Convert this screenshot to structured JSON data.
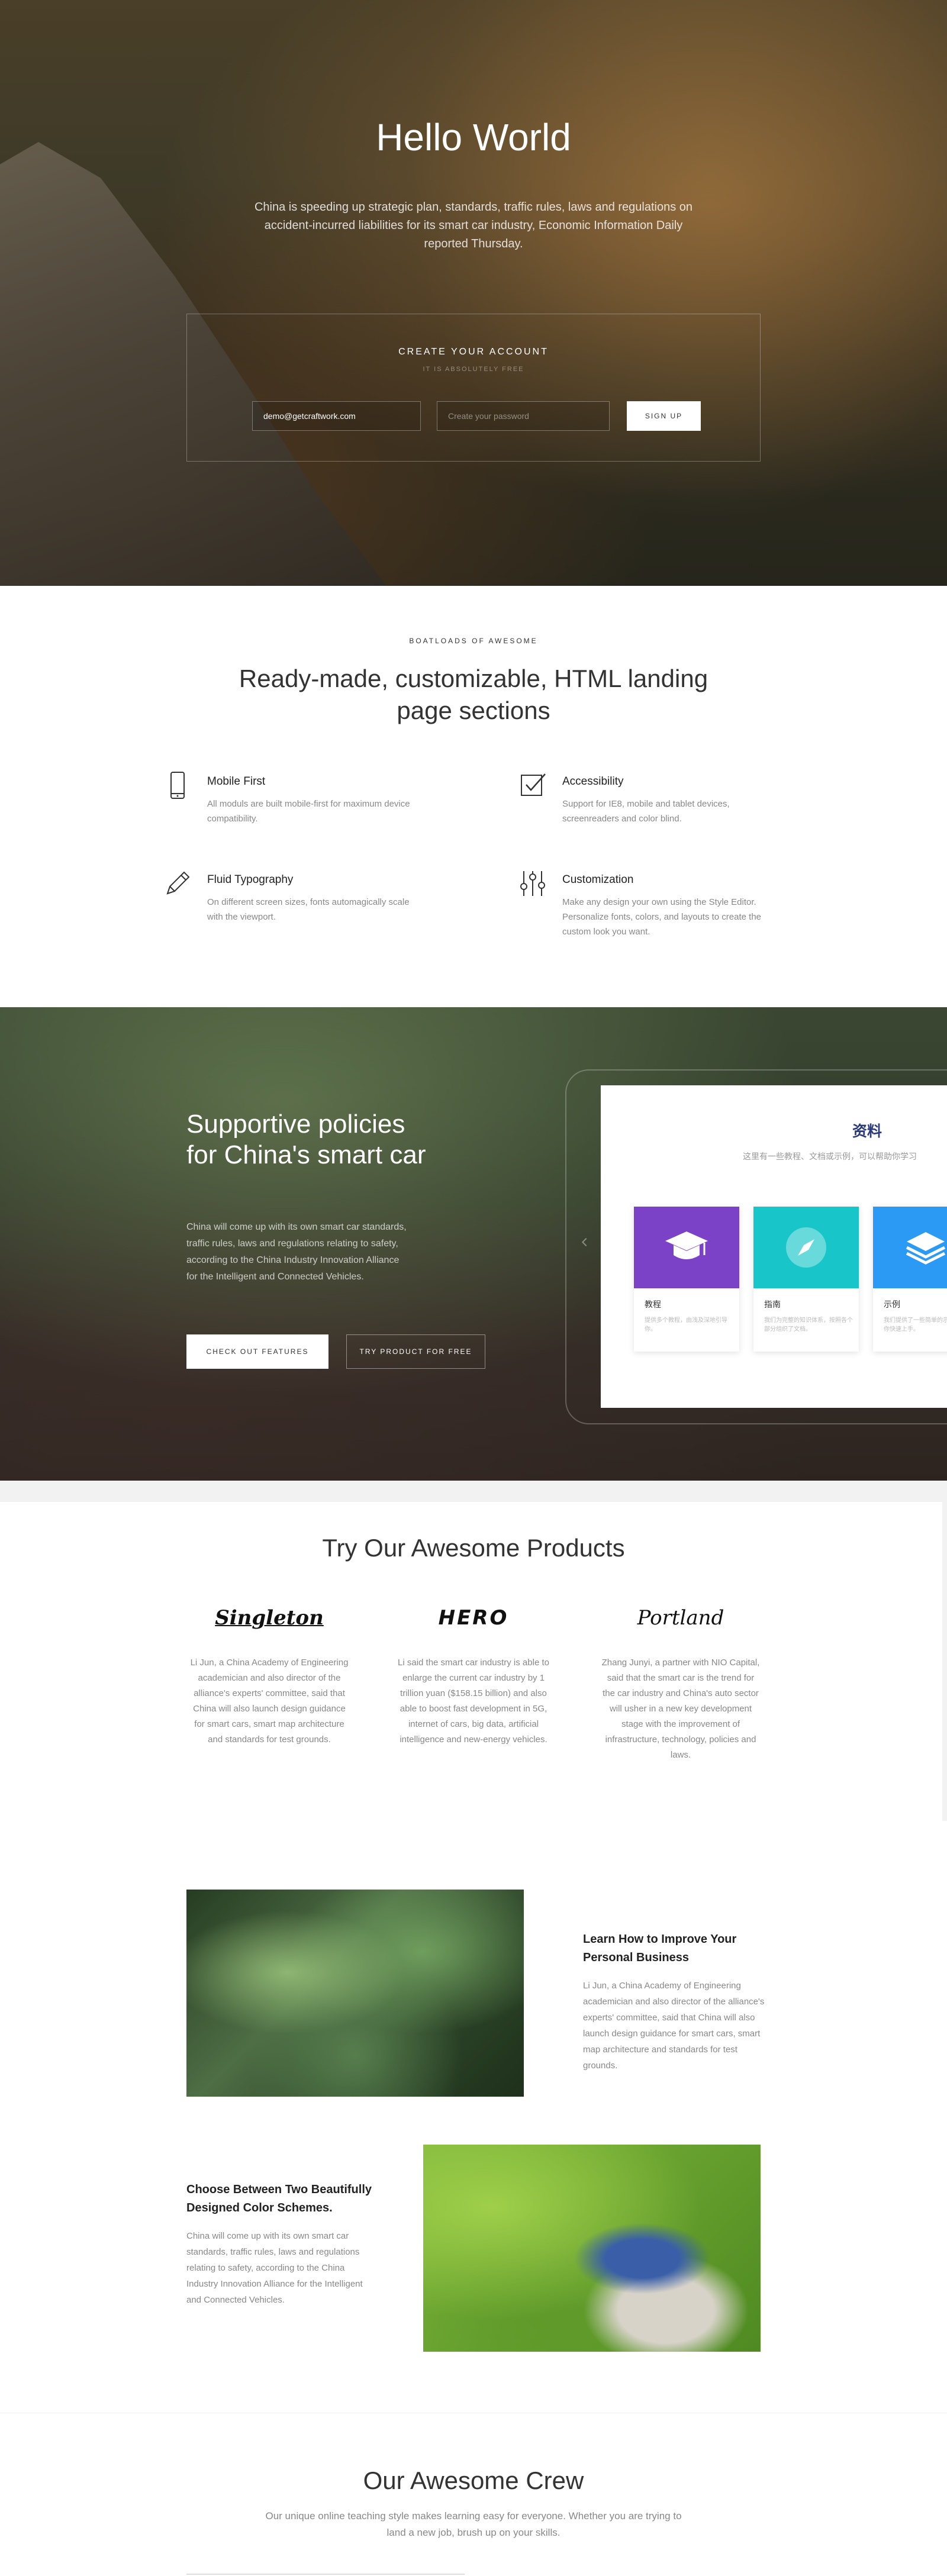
{
  "hero": {
    "title": "Hello World",
    "subtitle": "China is speeding up strategic plan, standards, traffic rules, laws and regulations on accident-incurred liabilities for its smart car industry, Economic Information Daily reported Thursday.",
    "signup": {
      "title": "CREATE YOUR ACCOUNT",
      "subtitle": "IT IS ABSOLUTELY FREE",
      "email_value": "demo@getcraftwork.com",
      "password_placeholder": "Create your password",
      "button_label": "SIGN UP"
    }
  },
  "features": {
    "eyebrow": "BOATLOADS OF AWESOME",
    "title": "Ready-made, customizable, HTML landing page sections",
    "items": [
      {
        "icon": "mobile-icon",
        "title": "Mobile First",
        "text": "All moduls are built mobile-first for maximum device compatibility."
      },
      {
        "icon": "checkbox-icon",
        "title": "Accessibility",
        "text": "Support for IE8, mobile and tablet devices, screenreaders and color blind."
      },
      {
        "icon": "pencil-icon",
        "title": "Fluid Typography",
        "text": "On different screen sizes, fonts automagically scale with the viewport."
      },
      {
        "icon": "sliders-icon",
        "title": "Customization",
        "text": "Make any design your own using the Style Editor. Personalize fonts, colors, and layouts to create the custom look you want."
      }
    ]
  },
  "policies": {
    "title": "Supportive policies for China's smart car",
    "text": "China will come up with its own smart car standards, traffic rules, laws and regulations relating to safety, according to the China Industry Innovation Alliance for the Intelligent and Connected Vehicles.",
    "primary_button": "CHECK OUT FEATURES",
    "secondary_button": "TRY PRODUCT FOR FREE",
    "screen": {
      "title": "资料",
      "subtitle": "这里有一些教程、文档或示例，可以帮助你学习",
      "cards": [
        {
          "icon": "graduation-cap-icon",
          "color": "#7b42c8",
          "title": "教程",
          "text": "提供多个教程，由浅及深地引导你。"
        },
        {
          "icon": "compass-icon",
          "color": "#18c6c9",
          "title": "指南",
          "text": "我们为完整的知识体系，按照各个部分组织了文档。"
        },
        {
          "icon": "layers-icon",
          "color": "#2a9af5",
          "title": "示例",
          "text": "我们提供了一些简单的示例，帮助你快速上手。"
        }
      ]
    }
  },
  "products": {
    "title": "Try Our Awesome Products",
    "items": [
      {
        "logo": "Singleton",
        "text": "Li Jun, a China Academy of Engineering academician and also director of the alliance's experts' committee, said that China will also launch design guidance for smart cars, smart map architecture and standards for test grounds."
      },
      {
        "logo": "HERO",
        "text": "Li said the smart car industry is able to enlarge the current car industry by 1 trillion yuan ($158.15 billion) and also able to boost fast development in 5G, internet of cars, big data, artificial intelligence and new-energy vehicles."
      },
      {
        "logo": "Portland",
        "text": "Zhang Junyi, a partner with NIO Capital, said that the smart car is the trend for the car industry and China's auto sector will usher in a new key development stage with the improvement of infrastructure, technology, policies and laws."
      }
    ]
  },
  "split": {
    "block1": {
      "title": "Learn How to Improve Your Personal Business",
      "text": "Li Jun, a China Academy of Engineering academician and also director of the alliance's experts' committee, said that China will also launch design guidance for smart cars, smart map architecture and standards for test grounds."
    },
    "block2": {
      "title": "Choose Between Two Beautifully Designed Color Schemes.",
      "text": "China will come up with its own smart car standards, traffic rules, laws and regulations relating to safety, according to the China Industry Innovation Alliance for the Intelligent and Connected Vehicles."
    }
  },
  "crew": {
    "title": "Our Awesome Crew",
    "subtitle": "Our unique online teaching style makes learning easy for everyone. Whether you are trying to land a new job, brush up on your skills."
  }
}
